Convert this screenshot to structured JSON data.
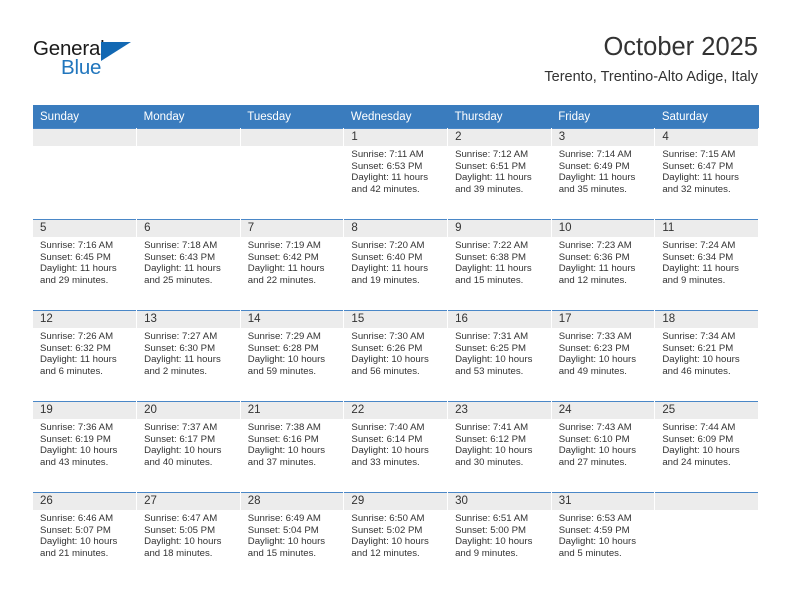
{
  "brand": {
    "name_part1": "General",
    "name_part2": "Blue",
    "accent_color": "#1268b3"
  },
  "header": {
    "month_title": "October 2025",
    "location": "Terento, Trentino-Alto Adige, Italy",
    "header_bg_color": "#3a7cbe"
  },
  "weekday_headers": [
    "Sunday",
    "Monday",
    "Tuesday",
    "Wednesday",
    "Thursday",
    "Friday",
    "Saturday"
  ],
  "weeks": [
    [
      {
        "day": "",
        "sunrise": "",
        "sunset": "",
        "daylight_line1": "",
        "daylight_line2": ""
      },
      {
        "day": "",
        "sunrise": "",
        "sunset": "",
        "daylight_line1": "",
        "daylight_line2": ""
      },
      {
        "day": "",
        "sunrise": "",
        "sunset": "",
        "daylight_line1": "",
        "daylight_line2": ""
      },
      {
        "day": "1",
        "sunrise": "Sunrise: 7:11 AM",
        "sunset": "Sunset: 6:53 PM",
        "daylight_line1": "Daylight: 11 hours",
        "daylight_line2": "and 42 minutes."
      },
      {
        "day": "2",
        "sunrise": "Sunrise: 7:12 AM",
        "sunset": "Sunset: 6:51 PM",
        "daylight_line1": "Daylight: 11 hours",
        "daylight_line2": "and 39 minutes."
      },
      {
        "day": "3",
        "sunrise": "Sunrise: 7:14 AM",
        "sunset": "Sunset: 6:49 PM",
        "daylight_line1": "Daylight: 11 hours",
        "daylight_line2": "and 35 minutes."
      },
      {
        "day": "4",
        "sunrise": "Sunrise: 7:15 AM",
        "sunset": "Sunset: 6:47 PM",
        "daylight_line1": "Daylight: 11 hours",
        "daylight_line2": "and 32 minutes."
      }
    ],
    [
      {
        "day": "5",
        "sunrise": "Sunrise: 7:16 AM",
        "sunset": "Sunset: 6:45 PM",
        "daylight_line1": "Daylight: 11 hours",
        "daylight_line2": "and 29 minutes."
      },
      {
        "day": "6",
        "sunrise": "Sunrise: 7:18 AM",
        "sunset": "Sunset: 6:43 PM",
        "daylight_line1": "Daylight: 11 hours",
        "daylight_line2": "and 25 minutes."
      },
      {
        "day": "7",
        "sunrise": "Sunrise: 7:19 AM",
        "sunset": "Sunset: 6:42 PM",
        "daylight_line1": "Daylight: 11 hours",
        "daylight_line2": "and 22 minutes."
      },
      {
        "day": "8",
        "sunrise": "Sunrise: 7:20 AM",
        "sunset": "Sunset: 6:40 PM",
        "daylight_line1": "Daylight: 11 hours",
        "daylight_line2": "and 19 minutes."
      },
      {
        "day": "9",
        "sunrise": "Sunrise: 7:22 AM",
        "sunset": "Sunset: 6:38 PM",
        "daylight_line1": "Daylight: 11 hours",
        "daylight_line2": "and 15 minutes."
      },
      {
        "day": "10",
        "sunrise": "Sunrise: 7:23 AM",
        "sunset": "Sunset: 6:36 PM",
        "daylight_line1": "Daylight: 11 hours",
        "daylight_line2": "and 12 minutes."
      },
      {
        "day": "11",
        "sunrise": "Sunrise: 7:24 AM",
        "sunset": "Sunset: 6:34 PM",
        "daylight_line1": "Daylight: 11 hours",
        "daylight_line2": "and 9 minutes."
      }
    ],
    [
      {
        "day": "12",
        "sunrise": "Sunrise: 7:26 AM",
        "sunset": "Sunset: 6:32 PM",
        "daylight_line1": "Daylight: 11 hours",
        "daylight_line2": "and 6 minutes."
      },
      {
        "day": "13",
        "sunrise": "Sunrise: 7:27 AM",
        "sunset": "Sunset: 6:30 PM",
        "daylight_line1": "Daylight: 11 hours",
        "daylight_line2": "and 2 minutes."
      },
      {
        "day": "14",
        "sunrise": "Sunrise: 7:29 AM",
        "sunset": "Sunset: 6:28 PM",
        "daylight_line1": "Daylight: 10 hours",
        "daylight_line2": "and 59 minutes."
      },
      {
        "day": "15",
        "sunrise": "Sunrise: 7:30 AM",
        "sunset": "Sunset: 6:26 PM",
        "daylight_line1": "Daylight: 10 hours",
        "daylight_line2": "and 56 minutes."
      },
      {
        "day": "16",
        "sunrise": "Sunrise: 7:31 AM",
        "sunset": "Sunset: 6:25 PM",
        "daylight_line1": "Daylight: 10 hours",
        "daylight_line2": "and 53 minutes."
      },
      {
        "day": "17",
        "sunrise": "Sunrise: 7:33 AM",
        "sunset": "Sunset: 6:23 PM",
        "daylight_line1": "Daylight: 10 hours",
        "daylight_line2": "and 49 minutes."
      },
      {
        "day": "18",
        "sunrise": "Sunrise: 7:34 AM",
        "sunset": "Sunset: 6:21 PM",
        "daylight_line1": "Daylight: 10 hours",
        "daylight_line2": "and 46 minutes."
      }
    ],
    [
      {
        "day": "19",
        "sunrise": "Sunrise: 7:36 AM",
        "sunset": "Sunset: 6:19 PM",
        "daylight_line1": "Daylight: 10 hours",
        "daylight_line2": "and 43 minutes."
      },
      {
        "day": "20",
        "sunrise": "Sunrise: 7:37 AM",
        "sunset": "Sunset: 6:17 PM",
        "daylight_line1": "Daylight: 10 hours",
        "daylight_line2": "and 40 minutes."
      },
      {
        "day": "21",
        "sunrise": "Sunrise: 7:38 AM",
        "sunset": "Sunset: 6:16 PM",
        "daylight_line1": "Daylight: 10 hours",
        "daylight_line2": "and 37 minutes."
      },
      {
        "day": "22",
        "sunrise": "Sunrise: 7:40 AM",
        "sunset": "Sunset: 6:14 PM",
        "daylight_line1": "Daylight: 10 hours",
        "daylight_line2": "and 33 minutes."
      },
      {
        "day": "23",
        "sunrise": "Sunrise: 7:41 AM",
        "sunset": "Sunset: 6:12 PM",
        "daylight_line1": "Daylight: 10 hours",
        "daylight_line2": "and 30 minutes."
      },
      {
        "day": "24",
        "sunrise": "Sunrise: 7:43 AM",
        "sunset": "Sunset: 6:10 PM",
        "daylight_line1": "Daylight: 10 hours",
        "daylight_line2": "and 27 minutes."
      },
      {
        "day": "25",
        "sunrise": "Sunrise: 7:44 AM",
        "sunset": "Sunset: 6:09 PM",
        "daylight_line1": "Daylight: 10 hours",
        "daylight_line2": "and 24 minutes."
      }
    ],
    [
      {
        "day": "26",
        "sunrise": "Sunrise: 6:46 AM",
        "sunset": "Sunset: 5:07 PM",
        "daylight_line1": "Daylight: 10 hours",
        "daylight_line2": "and 21 minutes."
      },
      {
        "day": "27",
        "sunrise": "Sunrise: 6:47 AM",
        "sunset": "Sunset: 5:05 PM",
        "daylight_line1": "Daylight: 10 hours",
        "daylight_line2": "and 18 minutes."
      },
      {
        "day": "28",
        "sunrise": "Sunrise: 6:49 AM",
        "sunset": "Sunset: 5:04 PM",
        "daylight_line1": "Daylight: 10 hours",
        "daylight_line2": "and 15 minutes."
      },
      {
        "day": "29",
        "sunrise": "Sunrise: 6:50 AM",
        "sunset": "Sunset: 5:02 PM",
        "daylight_line1": "Daylight: 10 hours",
        "daylight_line2": "and 12 minutes."
      },
      {
        "day": "30",
        "sunrise": "Sunrise: 6:51 AM",
        "sunset": "Sunset: 5:00 PM",
        "daylight_line1": "Daylight: 10 hours",
        "daylight_line2": "and 9 minutes."
      },
      {
        "day": "31",
        "sunrise": "Sunrise: 6:53 AM",
        "sunset": "Sunset: 4:59 PM",
        "daylight_line1": "Daylight: 10 hours",
        "daylight_line2": "and 5 minutes."
      },
      {
        "day": "",
        "sunrise": "",
        "sunset": "",
        "daylight_line1": "",
        "daylight_line2": ""
      }
    ]
  ]
}
